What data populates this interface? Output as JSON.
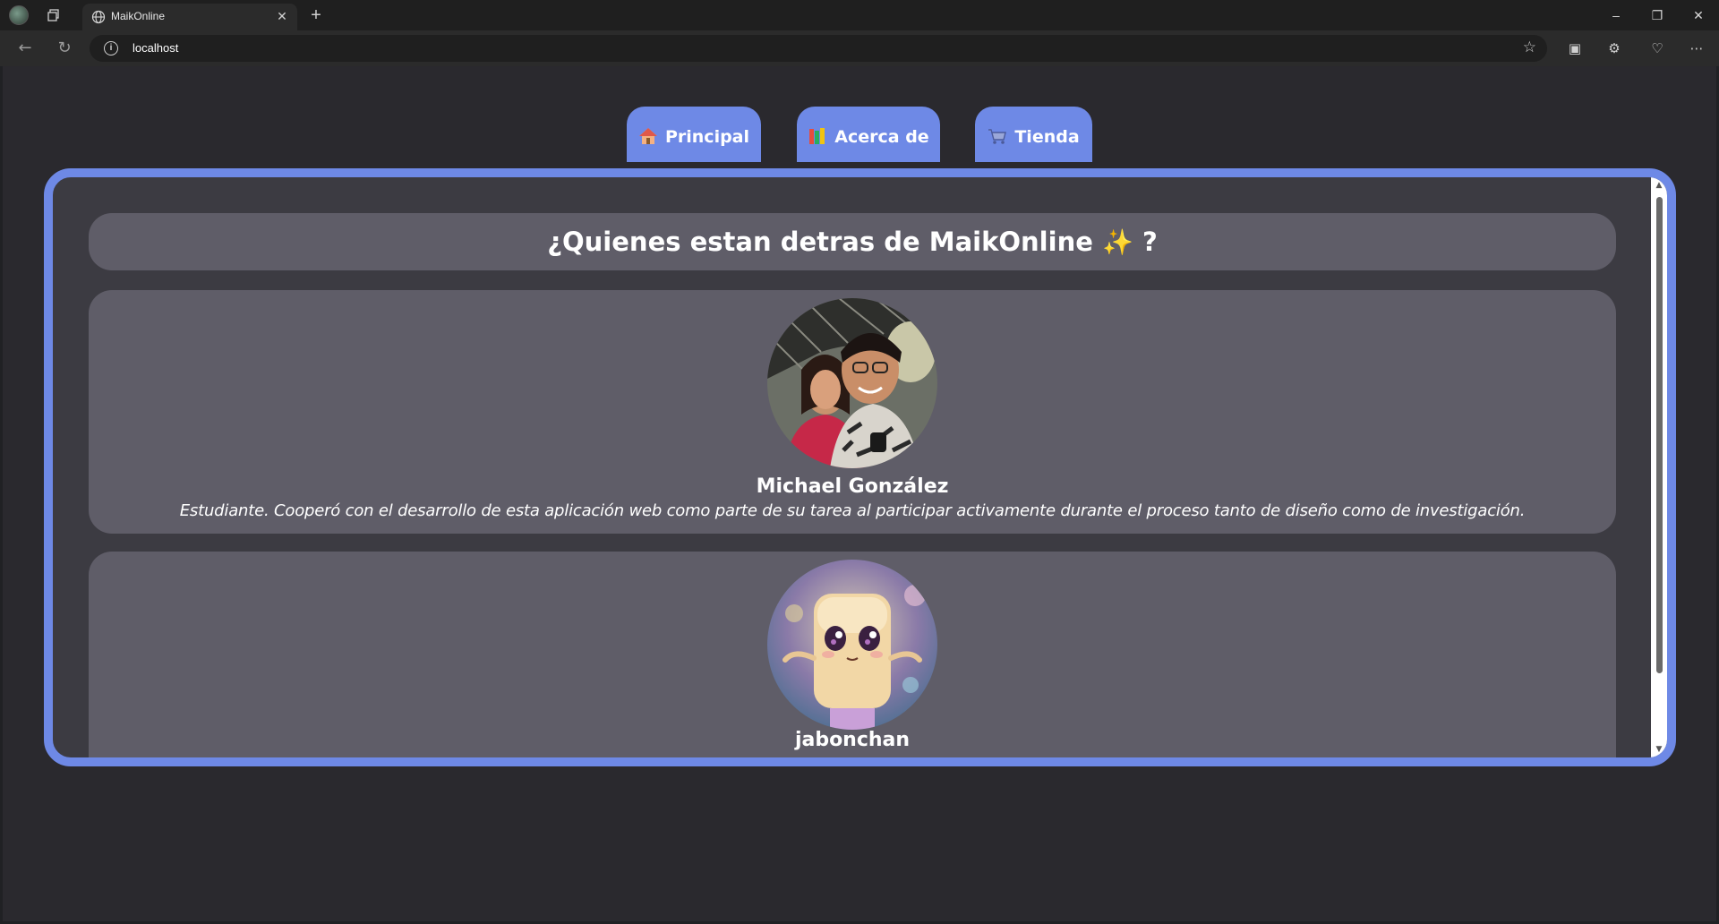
{
  "browser": {
    "tab_title": "MaikOnline",
    "url": "localhost",
    "new_tab_glyph": "+",
    "close_glyph": "✕",
    "window_controls": [
      "–",
      "❐",
      "✕"
    ]
  },
  "nav": {
    "tabs": [
      {
        "label": "Principal",
        "icon": "house-icon"
      },
      {
        "label": "Acerca de",
        "icon": "books-icon"
      },
      {
        "label": "Tienda",
        "icon": "shopping-cart-icon"
      }
    ]
  },
  "about": {
    "heading_text": "¿Quienes estan detras de MaikOnline",
    "heading_emoji": "✨",
    "heading_end": "?",
    "members": [
      {
        "name": "Michael González",
        "description": "Estudiante. Cooperó con el desarrollo de esta aplicación web como parte de su tarea al participar activamente durante el proceso tanto de diseño como de investigación.",
        "avatar": "couple-photo"
      },
      {
        "name": "jabonchan",
        "description": "",
        "avatar": "cartoon-soap-character"
      }
    ]
  },
  "colors": {
    "accent": "#6e89e6",
    "page_bg": "#2a292e",
    "panel_bg": "#3c3b42",
    "card_bg": "#5f5d68"
  }
}
